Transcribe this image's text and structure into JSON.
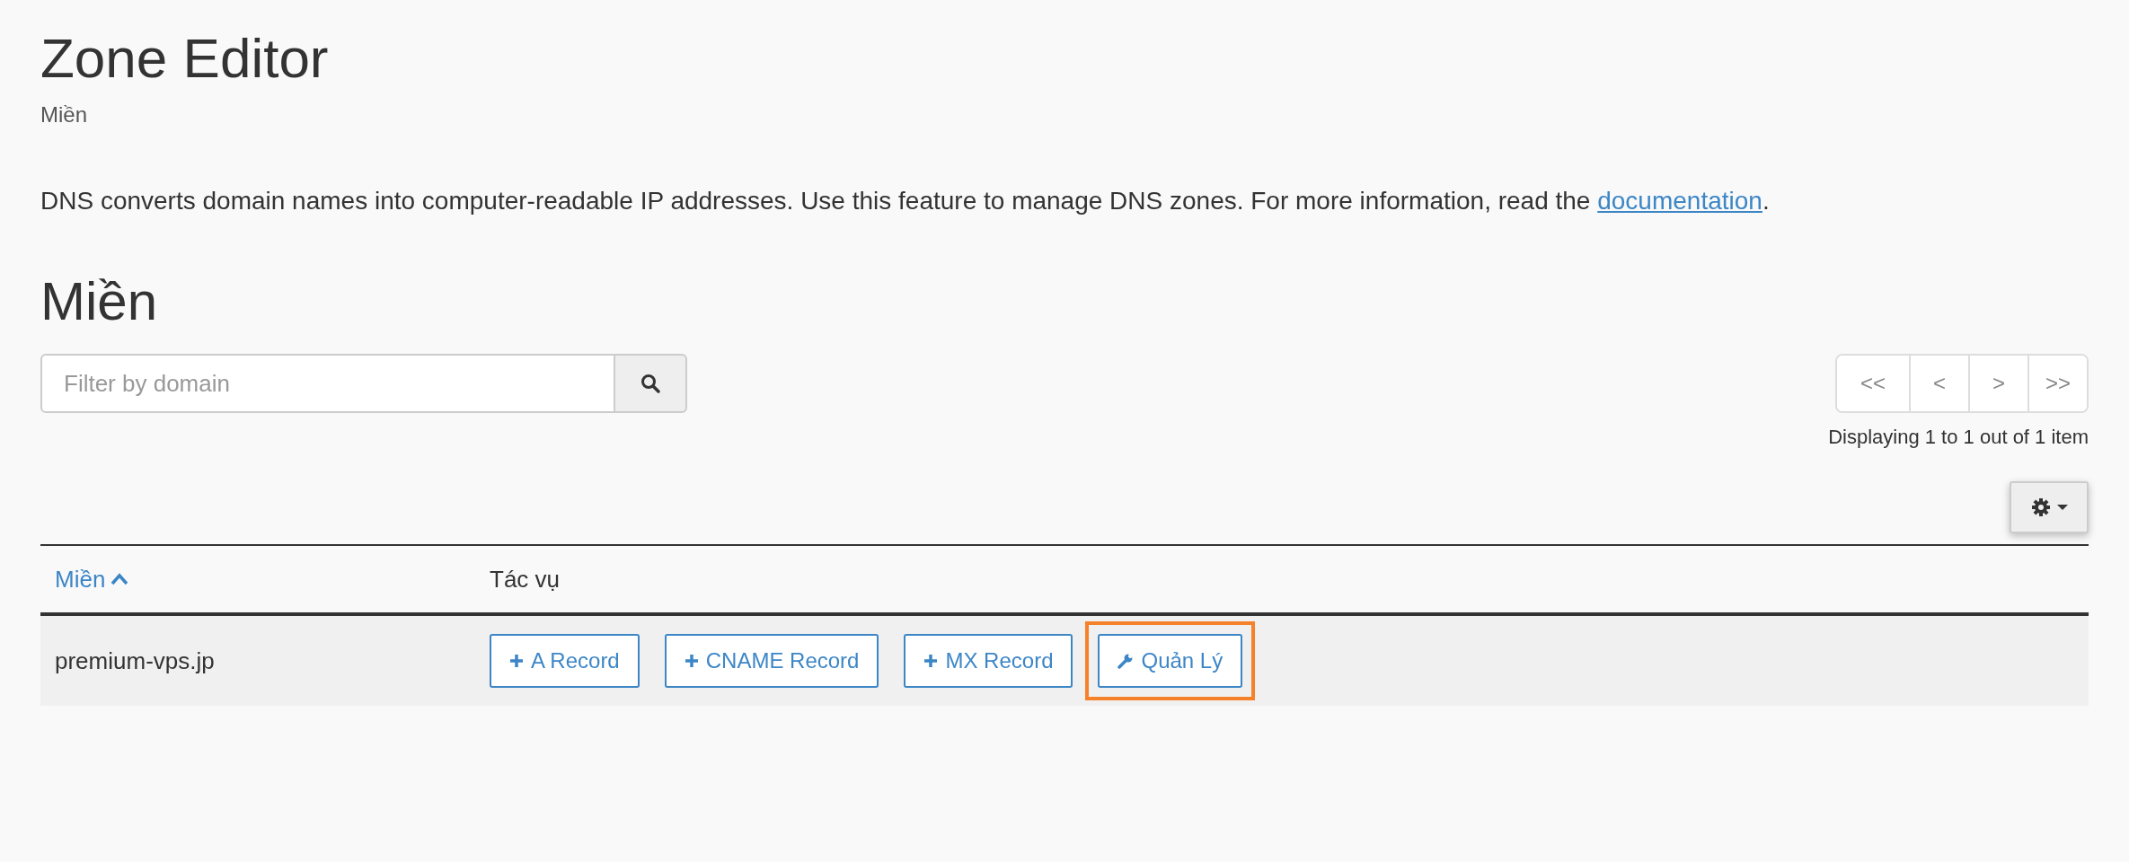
{
  "page": {
    "title": "Zone Editor",
    "subtitle": "Miền"
  },
  "intro": {
    "text": "DNS converts domain names into computer-readable IP addresses. Use this feature to manage DNS zones. For more information, read the ",
    "link": "documentation",
    "end": "."
  },
  "section_heading": "Miền",
  "search": {
    "placeholder": "Filter by domain"
  },
  "pagination": {
    "buttons": [
      "<<",
      "<",
      ">",
      ">>"
    ],
    "summary": "Displaying 1 to 1 out of 1 item"
  },
  "table": {
    "columns": [
      {
        "label": "Miền",
        "sortable": true
      },
      {
        "label": "Tác vụ",
        "sortable": false
      }
    ],
    "rows": [
      {
        "domain": "premium-vps.jp",
        "actions": [
          {
            "label": "A Record",
            "kind": "add",
            "highlighted": false
          },
          {
            "label": "CNAME Record",
            "kind": "add",
            "highlighted": false
          },
          {
            "label": "MX Record",
            "kind": "add",
            "highlighted": false
          },
          {
            "label": "Quản Lý",
            "kind": "manage",
            "highlighted": true
          }
        ]
      }
    ]
  }
}
